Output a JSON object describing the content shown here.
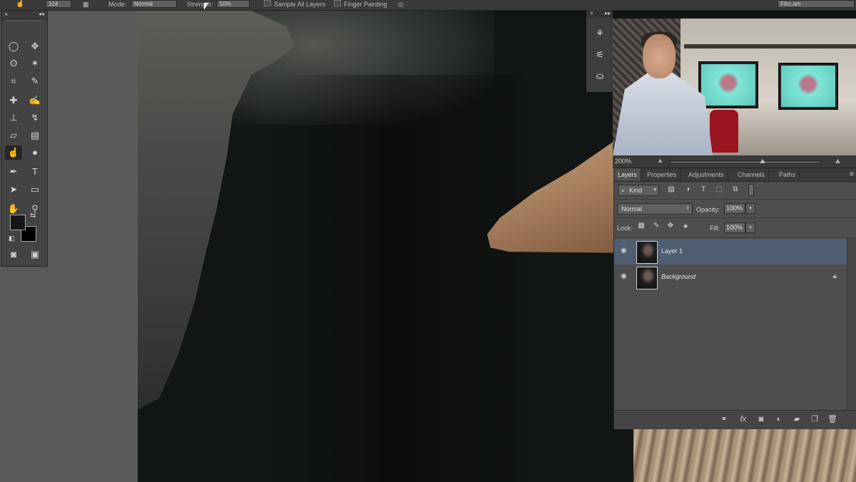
{
  "options_bar": {
    "size_value": "124",
    "mode_label": "Mode:",
    "mode_value": "Normal",
    "strength_label": "Strength:",
    "strength_value": "50%",
    "sample_all_layers_label": "Sample All Layers",
    "finger_painting_label": "Finger Painting",
    "workspace_value": "Film.am"
  },
  "toolbar": {
    "close_glyph": "×",
    "collapse_glyph": "◂◂",
    "tools": [
      {
        "name": "elliptical-marquee-icon",
        "glyph": "◯"
      },
      {
        "name": "move-icon",
        "glyph": "✥"
      },
      {
        "name": "lasso-icon",
        "glyph": "ʘ"
      },
      {
        "name": "magic-wand-icon",
        "glyph": "✶"
      },
      {
        "name": "crop-icon",
        "glyph": "⌗"
      },
      {
        "name": "eyedropper-icon",
        "glyph": "✎"
      },
      {
        "name": "healing-brush-icon",
        "glyph": "✚"
      },
      {
        "name": "brush-icon",
        "glyph": "✍"
      },
      {
        "name": "clone-stamp-icon",
        "glyph": "⊥"
      },
      {
        "name": "history-brush-icon",
        "glyph": "↯"
      },
      {
        "name": "eraser-icon",
        "glyph": "▱"
      },
      {
        "name": "gradient-icon",
        "glyph": "▤"
      },
      {
        "name": "smudge-icon",
        "glyph": "☝"
      },
      {
        "name": "dodge-icon",
        "glyph": "●"
      },
      {
        "name": "pen-icon",
        "glyph": "✒"
      },
      {
        "name": "type-icon",
        "glyph": "T"
      },
      {
        "name": "path-selection-icon",
        "glyph": "➤"
      },
      {
        "name": "rectangle-shape-icon",
        "glyph": "▭"
      },
      {
        "name": "hand-icon",
        "glyph": "✋"
      },
      {
        "name": "zoom-icon",
        "glyph": "⚲"
      },
      {
        "name": "quick-mask-icon",
        "glyph": "◙"
      },
      {
        "name": "screen-mode-icon",
        "glyph": "▣"
      }
    ],
    "active_tool": "smudge-icon",
    "foreground_color": "#161616",
    "background_color": "#000000"
  },
  "dock": {
    "close_glyph": "×",
    "expand_glyph": "▸▸",
    "icons": [
      {
        "name": "brush-presets-icon",
        "glyph": "⚘"
      },
      {
        "name": "tool-presets-icon",
        "glyph": "⚟"
      },
      {
        "name": "clone-source-icon",
        "glyph": "⛀"
      }
    ]
  },
  "navigator": {
    "zoom": "200%"
  },
  "layers_panel": {
    "tabs": [
      {
        "label": "Layers",
        "active": true
      },
      {
        "label": "Properties",
        "active": false
      },
      {
        "label": "Adjustments",
        "active": false
      },
      {
        "label": "Channels",
        "active": false
      },
      {
        "label": "Paths",
        "active": false
      }
    ],
    "menu_glyph": "≡",
    "filter_kind": "Kind",
    "search_glyph": "⌕",
    "blend_mode": "Normal",
    "opacity_label": "Opacity:",
    "opacity_value": "100%",
    "lock_label": "Lock:",
    "fill_label": "Fill:",
    "fill_value": "100%",
    "arrow_glyph": "▾",
    "layers": [
      {
        "name": "Layer 1",
        "selected": true,
        "locked": false
      },
      {
        "name": "Background",
        "selected": false,
        "locked": true
      }
    ],
    "accent_color": "#4f5e73"
  }
}
